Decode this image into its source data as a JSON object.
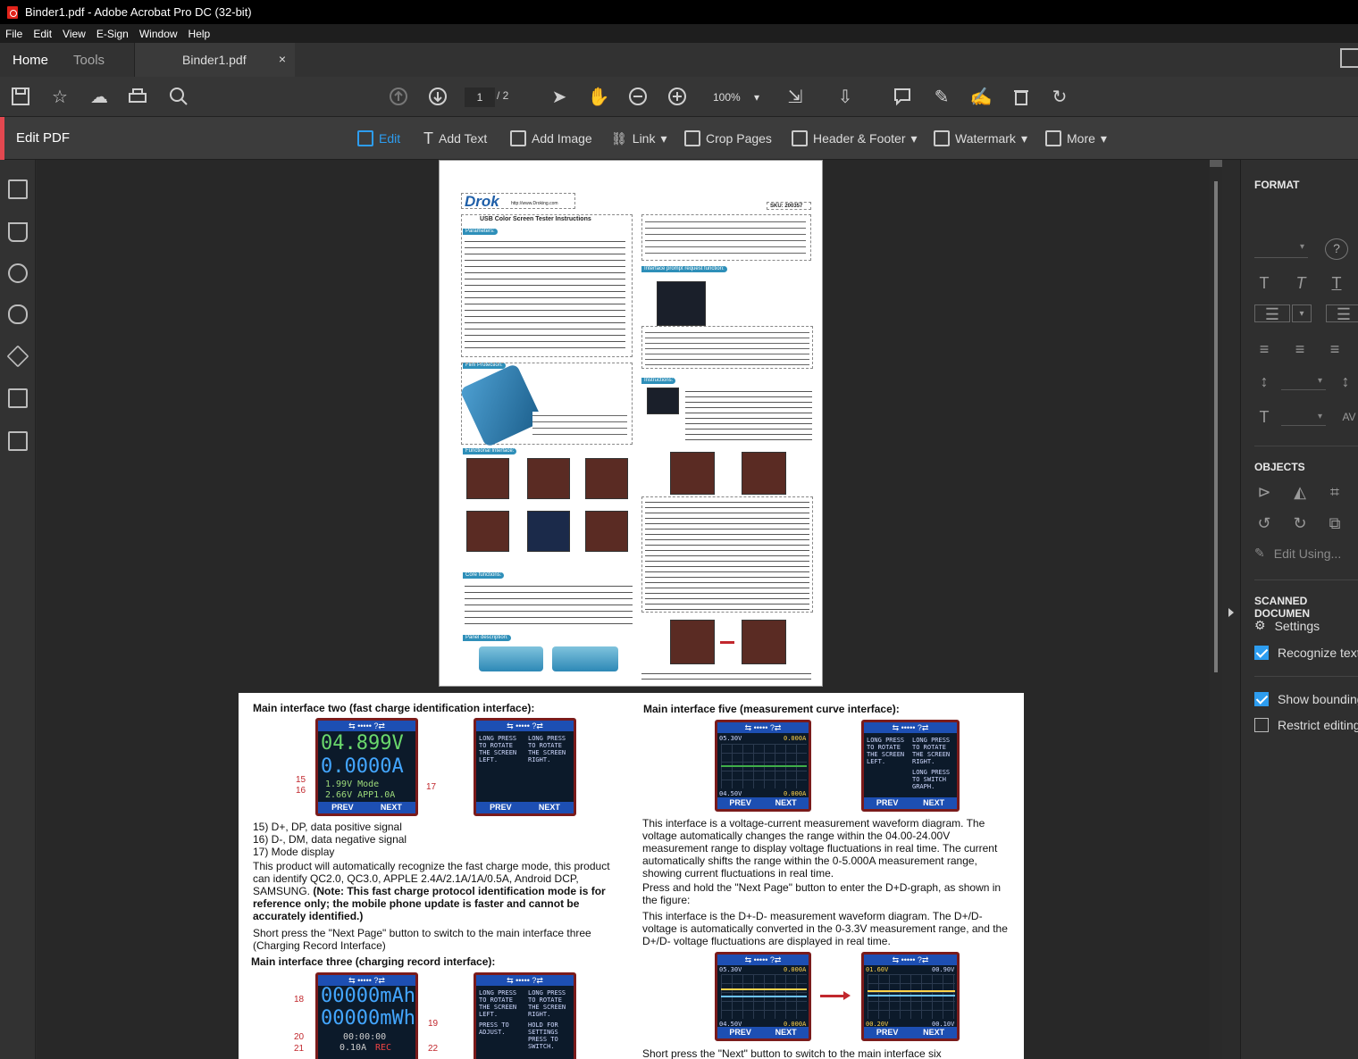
{
  "window": {
    "title": "Binder1.pdf - Adobe Acrobat Pro DC (32-bit)"
  },
  "menu": [
    "File",
    "Edit",
    "View",
    "E-Sign",
    "Window",
    "Help"
  ],
  "tabs": {
    "home": "Home",
    "tools": "Tools",
    "document": "Binder1.pdf",
    "close": "×"
  },
  "toolbar": {
    "page_current": "1",
    "page_total": "/ 2",
    "zoom": "100%"
  },
  "editbar": {
    "title": "Edit PDF",
    "items": [
      "Edit",
      "Add Text",
      "Add Image",
      "Link",
      "Crop Pages",
      "Header & Footer",
      "Watermark",
      "More"
    ]
  },
  "panel": {
    "format": "FORMAT",
    "objects": "OBJECTS",
    "edit_using": "Edit Using...",
    "scanned": "SCANNED DOCUMEN",
    "settings": "Settings",
    "recognize": "Recognize text",
    "show_bounding": "Show bounding",
    "restrict": "Restrict editing",
    "recognize_checked": true,
    "show_bounding_checked": true,
    "restrict_checked": false
  },
  "page1": {
    "logo": "Drok",
    "url": "http://www.Droking.com",
    "sku": "SKU: 200357",
    "title": "USB Color Screen Tester Instructions",
    "sections": [
      "Parameters:",
      "Film Protection:",
      "Functional Interface:",
      "Core functions:",
      "Panel description:",
      "Interface prompt request function:",
      "Instructions:"
    ]
  },
  "page2": {
    "left_title": "Main interface two (fast charge identification interface):",
    "lcd1_v": "04.899V",
    "lcd1_a": "0.0000A",
    "lcd1_line1": "1.99V   Mode",
    "lcd1_line2": "2.66V APP1.0A",
    "prev": "PREV",
    "next": "NEXT",
    "labels_a": [
      "15",
      "16",
      "17"
    ],
    "list": [
      "15) D+, DP, data positive signal",
      "16) D-, DM, data negative signal",
      "17) Mode display"
    ],
    "para1_plain": "This product will automatically recognize the fast charge mode, this product can identify QC2.0, QC3.0, APPLE 2.4A/2.1A/1A/0.5A, Android DCP, SAMSUNG. ",
    "para1_bold": "(Note: This fast charge protocol identification mode is for reference only; the mobile phone update is faster and cannot be accurately identified.)",
    "para2": "Short press the \"Next Page\" button to switch to the main interface three (Charging Record Interface)",
    "left_title2": "Main interface three (charging record interface):",
    "lcd3_mah": "00000mAh",
    "lcd3_mwh": "00000mWh",
    "lcd3_time": "00:00:00",
    "lcd3_a": "0.10A",
    "lcd3_rec": "REC",
    "labels_b": [
      "18",
      "19",
      "20",
      "21",
      "22"
    ],
    "rotate_text": "LONG PRESS TO ROTATE THE SCREEN LEFT.",
    "rotate_text_r": "LONG PRESS TO ROTATE THE SCREEN RIGHT.",
    "adjust_text": "PRESS TO ADJUST.",
    "hold_text": "HOLD FOR SETTINGS PRESS TO SWITCH.",
    "right_title": "Main interface five (measurement curve interface):",
    "curve_v": "05.30V",
    "curve_a": "0.000A",
    "curve_v2": "04.50V",
    "curve_a2": "0.000A",
    "graph_text": "LONG PRESS TO SWITCH GRAPH.",
    "para3": "This interface is a voltage-current measurement waveform diagram. The voltage automatically changes the range within the 04.00-24.00V measurement range to display voltage fluctuations in real time. The current automatically shifts the range within the 0-5.000A measurement range, showing current fluctuations in real time.",
    "para4": "Press and hold the \"Next Page\" button to enter the D+D-graph, as shown in the figure:",
    "para5": "This interface is the D+-D- measurement waveform diagram. The D+/D- voltage is automatically converted in the 0-3.3V measurement range, and the D+/D- voltage fluctuations are displayed in real time.",
    "dd_v1": "01.60V",
    "dd_v2": "00.90V",
    "dd_v3": "00.20V",
    "dd_v4": "00.10V",
    "para6": "Short press the \"Next\" button to switch to the main interface six"
  }
}
